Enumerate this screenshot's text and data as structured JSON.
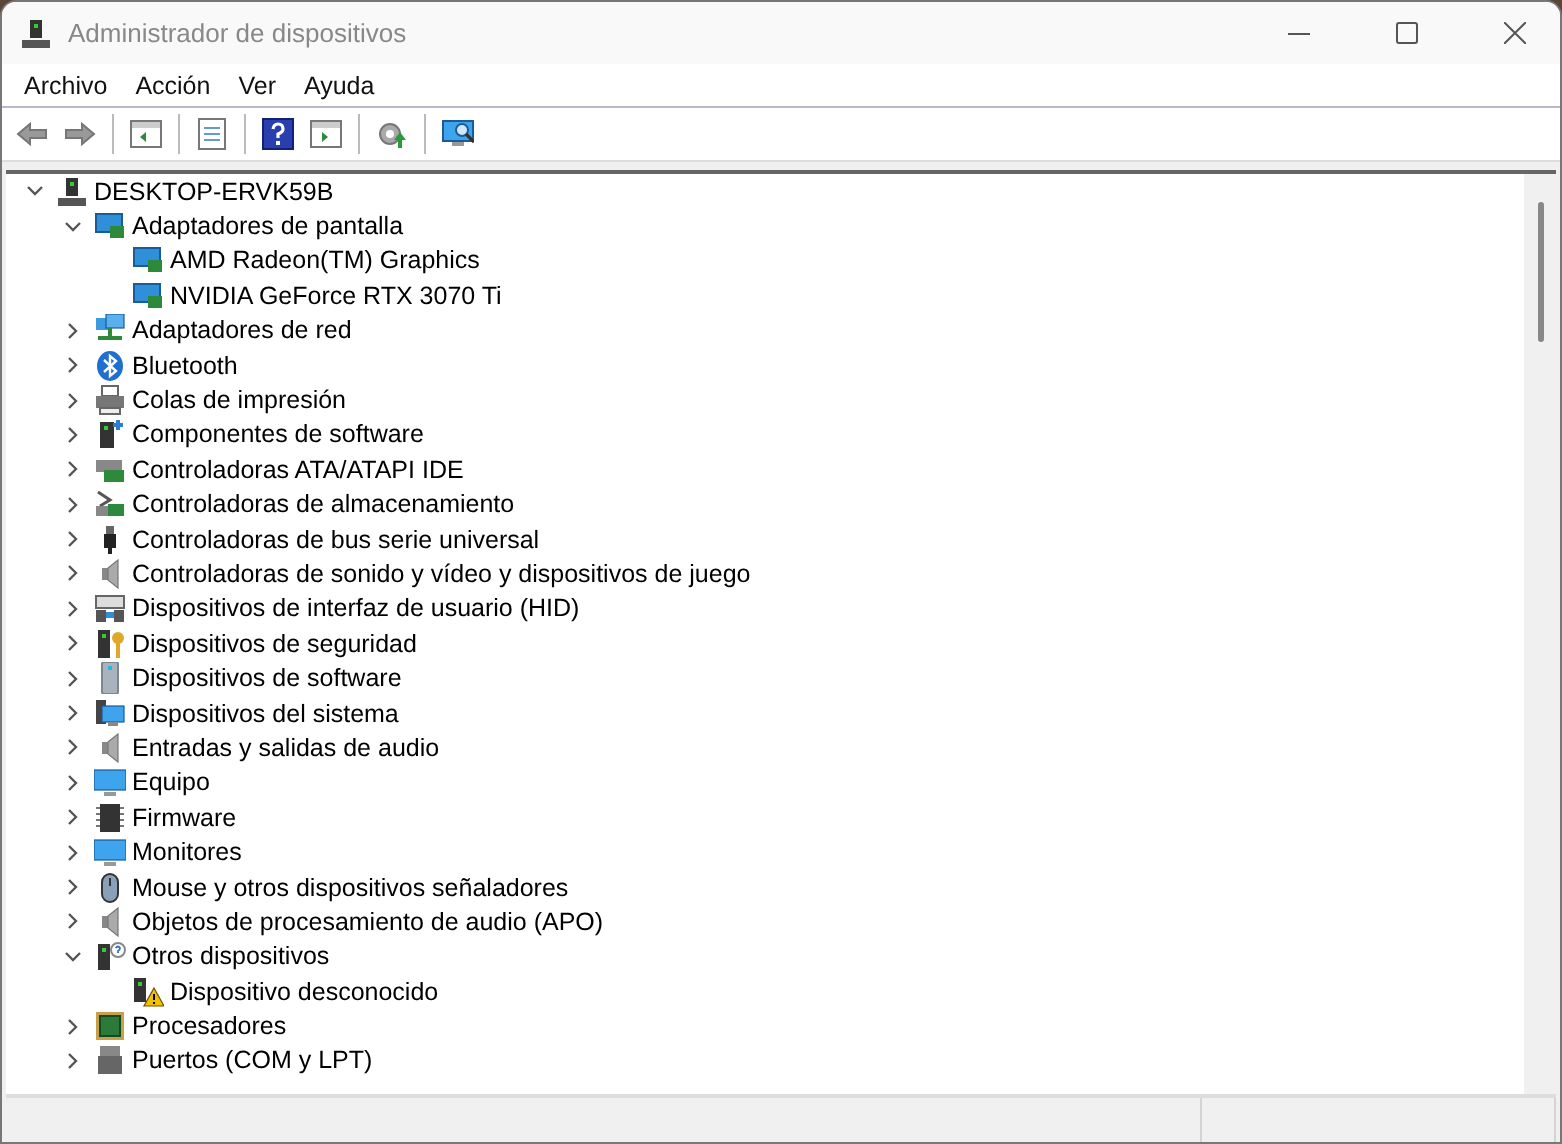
{
  "window": {
    "title": "Administrador de dispositivos"
  },
  "menu": [
    "Archivo",
    "Acción",
    "Ver",
    "Ayuda"
  ],
  "tree": {
    "label": "DESKTOP-ERVK59B",
    "expanded": true,
    "children": [
      {
        "label": "Adaptadores de pantalla",
        "expanded": true,
        "children": [
          {
            "label": "AMD Radeon(TM) Graphics"
          },
          {
            "label": "NVIDIA GeForce RTX 3070 Ti"
          }
        ]
      },
      {
        "label": "Adaptadores de red",
        "expanded": false
      },
      {
        "label": "Bluetooth",
        "expanded": false
      },
      {
        "label": "Colas de impresión",
        "expanded": false
      },
      {
        "label": "Componentes de software",
        "expanded": false
      },
      {
        "label": "Controladoras ATA/ATAPI IDE",
        "expanded": false
      },
      {
        "label": "Controladoras de almacenamiento",
        "expanded": false
      },
      {
        "label": "Controladoras de bus serie universal",
        "expanded": false
      },
      {
        "label": "Controladoras de sonido y vídeo y dispositivos de juego",
        "expanded": false
      },
      {
        "label": "Dispositivos de interfaz de usuario (HID)",
        "expanded": false
      },
      {
        "label": "Dispositivos de seguridad",
        "expanded": false
      },
      {
        "label": "Dispositivos de software",
        "expanded": false
      },
      {
        "label": "Dispositivos del sistema",
        "expanded": false
      },
      {
        "label": "Entradas y salidas de audio",
        "expanded": false
      },
      {
        "label": "Equipo",
        "expanded": false
      },
      {
        "label": "Firmware",
        "expanded": false
      },
      {
        "label": "Monitores",
        "expanded": false
      },
      {
        "label": "Mouse y otros dispositivos señaladores",
        "expanded": false
      },
      {
        "label": "Objetos de procesamiento de audio (APO)",
        "expanded": false
      },
      {
        "label": "Otros dispositivos",
        "expanded": true,
        "children": [
          {
            "label": "Dispositivo desconocido"
          }
        ]
      },
      {
        "label": "Procesadores",
        "expanded": false
      },
      {
        "label": "Puertos (COM y LPT)",
        "expanded": false
      }
    ]
  }
}
